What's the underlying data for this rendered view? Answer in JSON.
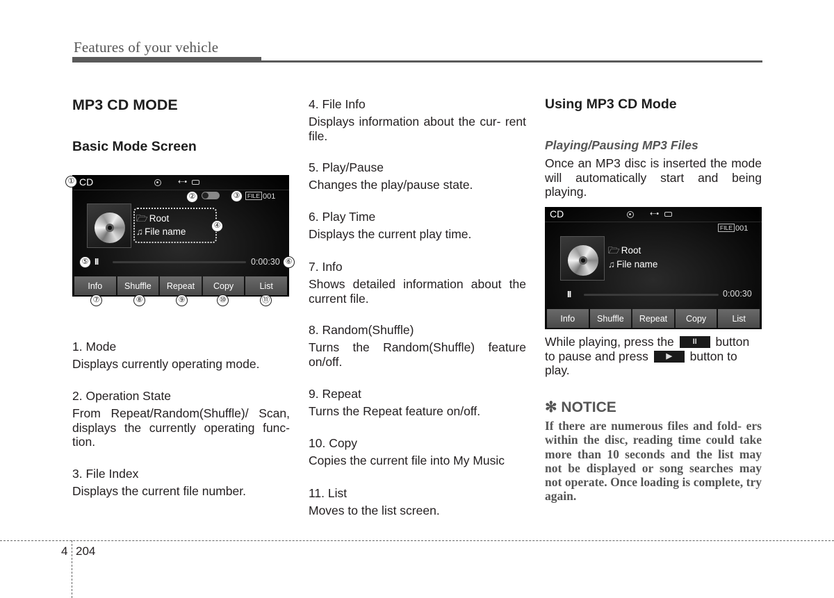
{
  "header": {
    "running_head": "Features of your vehicle"
  },
  "left": {
    "title": "MP3 CD MODE",
    "subtitle": "Basic Mode Screen",
    "items": [
      {
        "title": "1. Mode",
        "body": "Displays currently operating mode."
      },
      {
        "title": "2. Operation State",
        "body": "From Repeat/Random(Shuffle)/ Scan, displays the currently operating func- tion."
      },
      {
        "title": "3. File Index",
        "body": "Displays the current file number."
      }
    ]
  },
  "middle": {
    "items": [
      {
        "title": "4. File Info",
        "body": "Displays information about the cur- rent file."
      },
      {
        "title": "5. Play/Pause",
        "body": "Changes the play/pause state."
      },
      {
        "title": "6. Play Time",
        "body": "Displays the current play time."
      },
      {
        "title": "7. Info",
        "body": "Shows detailed information about the current file."
      },
      {
        "title": "8. Random(Shuffle)",
        "body": "Turns the Random(Shuffle) feature on/off."
      },
      {
        "title": "9. Repeat",
        "body": "Turns the Repeat feature on/off."
      },
      {
        "title": "10. Copy",
        "body": "Copies the current file into My Music"
      },
      {
        "title": "11. List",
        "body": "Moves to the list screen."
      }
    ]
  },
  "right": {
    "title": "Using MP3 CD Mode",
    "subheading": "Playing/Pausing MP3 Files",
    "intro": "Once an MP3 disc is inserted the mode will automatically start and being playing.",
    "instruction_a": "While playing, press the",
    "instruction_b": "button to pause and press",
    "instruction_c": "button to play.",
    "pause_glyph": "II",
    "play_glyph": "▶",
    "notice_title": "✻ NOTICE",
    "notice_body": "If there are numerous files and fold- ers within the disc, reading time could take more than 10 seconds and the list may not be displayed or song searches may not operate. Once loading is complete, try again."
  },
  "screen": {
    "mode": "CD",
    "file_tag": "FILE",
    "file_index": "001",
    "folder": "Root",
    "file_name": "File name",
    "pause_glyph": "II",
    "play_time": "0:00:30",
    "folder_glyph": "🗁",
    "note_glyph": "♫",
    "usb_glyph": "⭠",
    "buttons": [
      "Info",
      "Shuffle",
      "Repeat",
      "Copy",
      "List"
    ]
  },
  "callouts": {
    "mode": "①",
    "op_state": "②",
    "file_index": "③",
    "file_info": "④",
    "play_pause": "⑤",
    "play_time": "⑥",
    "info": "⑦",
    "shuffle": "⑧",
    "repeat": "⑨",
    "copy": "⑩",
    "list": "⑪"
  },
  "footer": {
    "chapter": "4",
    "page": "204"
  }
}
